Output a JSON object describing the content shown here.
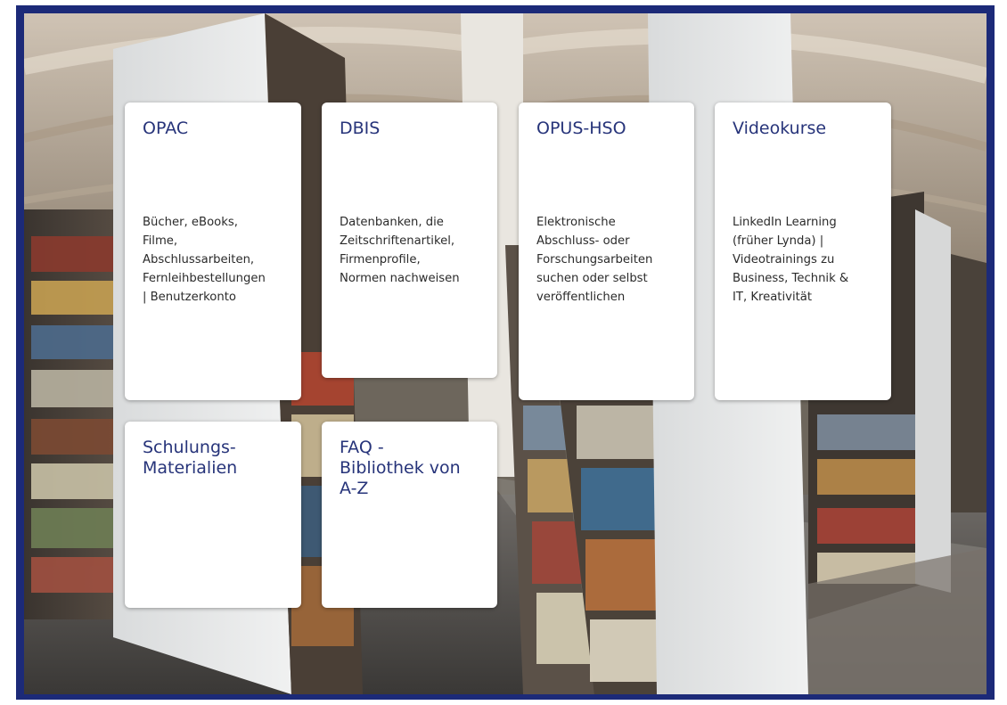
{
  "tiles": [
    {
      "title": "OPAC",
      "description": "Bücher, eBooks,\nFilme,\nAbschlussarbeiten,\nFernleihbestellungen\n| Benutzerkonto"
    },
    {
      "title": "DBIS",
      "description": "Datenbanken, die\nZeitschriftenartikel,\nFirmenprofile,\nNormen nachweisen"
    },
    {
      "title": "OPUS-HSO",
      "description": "Elektronische\nAbschluss- oder\nForschungsarbeiten\nsuchen oder selbst\nveröffentlichen"
    },
    {
      "title": "Videokurse",
      "description": "LinkedIn Learning\n(früher Lynda) |\nVideotrainings zu\nBusiness, Technik &\nIT, Kreativität"
    },
    {
      "title": "Schulungs-\nMaterialien",
      "description": ""
    },
    {
      "title": "FAQ -\nBibliothek von\nA-Z",
      "description": ""
    }
  ],
  "colors": {
    "frame_border": "#1c2a78",
    "tile_title": "#27347a",
    "tile_background": "#ffffff"
  },
  "background": "library-bookshelves-photo"
}
